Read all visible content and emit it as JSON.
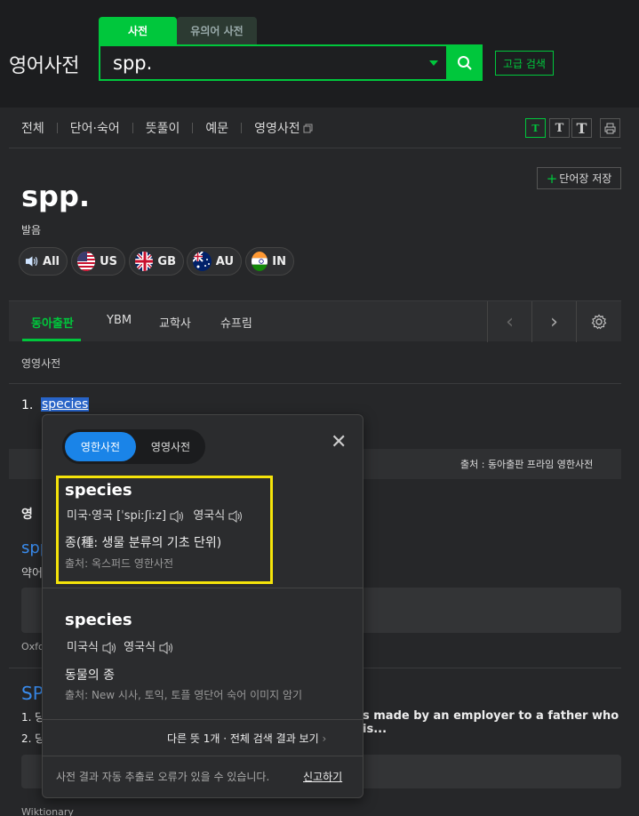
{
  "header": {
    "logo": "영어사전",
    "tabs": [
      "사전",
      "유의어 사전"
    ],
    "search_value": "spp.",
    "advanced_search": "고급 검색"
  },
  "nav": {
    "items": [
      "전체",
      "단어·숙어",
      "뜻풀이",
      "예문",
      "영영사전"
    ],
    "font_buttons": [
      "T",
      "T",
      "T"
    ]
  },
  "entry": {
    "word": "spp.",
    "pron_label": "발음",
    "pron_buttons": [
      "All",
      "US",
      "GB",
      "AU",
      "IN"
    ],
    "wordbook": "단어장 저장"
  },
  "source_tabs": [
    "동아출판",
    "YBM",
    "교학사",
    "슈프림"
  ],
  "section_label": "영영사전",
  "definition": {
    "number": "1.",
    "word": "species"
  },
  "source_line": "출처 : 동아출판 프라임 영한사전",
  "background": {
    "heading": "영",
    "spp": "spp",
    "yak": "약어",
    "oxford": "Oxfo",
    "sp_title": "SP",
    "line1_num": "1. 당",
    "line1_text": "s made by an employer to a father who is...",
    "line2_num": "2. 당",
    "wiktionary": "Wiktionary"
  },
  "popup": {
    "toggle": [
      "영한사전",
      "영영사전"
    ],
    "entries": [
      {
        "word": "species",
        "pron": "미국·영국 [ˈspiːʃiːz]",
        "pron2": "영국식",
        "def": "종(種: 생물 분류의 기초 단위)",
        "source": "출처: 옥스퍼드 영한사전"
      },
      {
        "word": "species",
        "pron": "미국식",
        "pron2": "영국식",
        "def": "동물의 종",
        "source": "출처: New 시사, 토익, 토플 영단어 숙어 이미지 암기"
      }
    ],
    "more": "다른 뜻 1개 · 전체 검색 결과 보기",
    "notice": "사전 결과 자동 추출로 오류가 있을 수 있습니다.",
    "report": "신고하기"
  },
  "colors": {
    "accent": "#00c73c",
    "highlight_border": "#f5e40a",
    "toggle_active": "#1a84e8",
    "link_blue": "#3a8df0"
  }
}
